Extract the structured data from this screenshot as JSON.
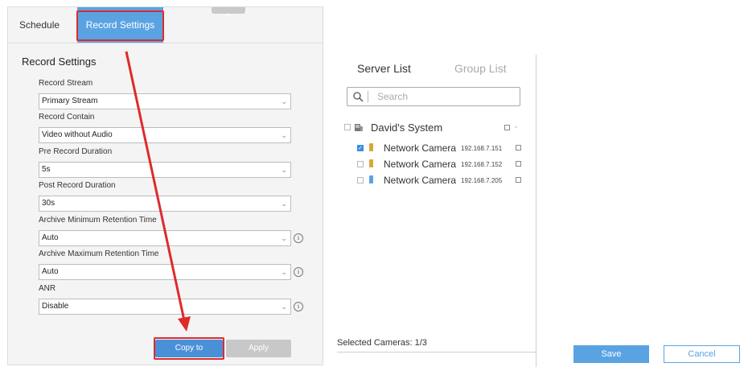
{
  "tabs": {
    "schedule": "Schedule",
    "record_settings": "Record Settings"
  },
  "section_title": "Record Settings",
  "fields": [
    {
      "label": "Record Stream",
      "value": "Primary Stream",
      "info": false
    },
    {
      "label": "Record Contain",
      "value": "Video without Audio",
      "info": false
    },
    {
      "label": "Pre Record Duration",
      "value": "5s",
      "info": false
    },
    {
      "label": "Post Record Duration",
      "value": "30s",
      "info": false
    },
    {
      "label": "Archive Minimum Retention Time",
      "value": "Auto",
      "info": true
    },
    {
      "label": "Archive Maximum Retention Time",
      "value": "Auto",
      "info": true
    },
    {
      "label": "ANR",
      "value": "Disable",
      "info": true
    }
  ],
  "buttons": {
    "copy_to": "Copy to",
    "apply": "Apply",
    "save": "Save",
    "cancel": "Cancel"
  },
  "server_tree": {
    "tab_server_list": "Server List",
    "tab_group_list": "Group List",
    "search_placeholder": "Search",
    "system_name": "David's System",
    "cameras": [
      {
        "name": "Network Camera",
        "ip": "192.168.7.151",
        "checked": true
      },
      {
        "name": "Network Camera",
        "ip": "192.168.7.152",
        "checked": false
      },
      {
        "name": "Network Camera",
        "ip": "192.168.7.205",
        "checked": false
      }
    ],
    "selected_label": "Selected Cameras:",
    "selected_count": "1/3"
  },
  "colors": {
    "accent": "#5aa3e3",
    "annotation": "#e02a2a"
  }
}
